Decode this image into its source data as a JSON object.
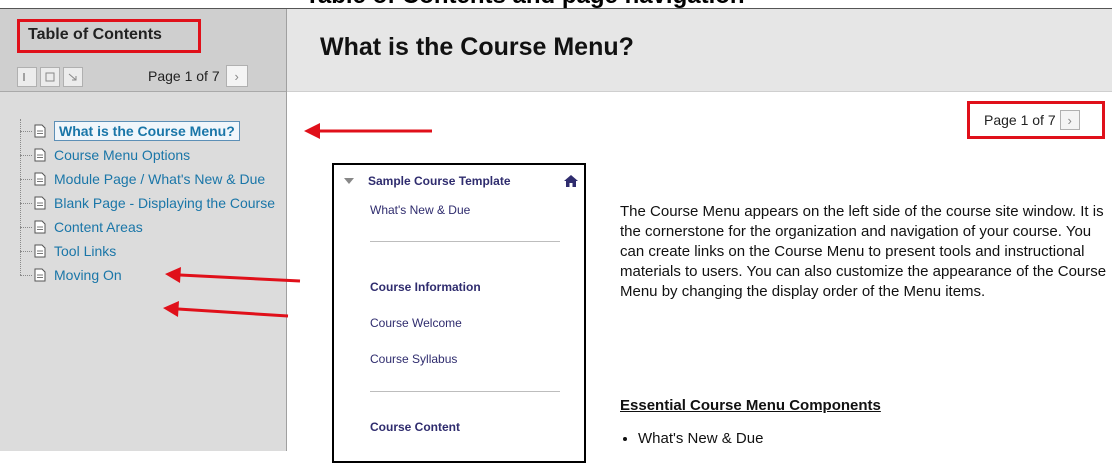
{
  "caption": {
    "text": "Table of Contents and page navigation"
  },
  "toc": {
    "title": "Table of Contents",
    "pager": {
      "label": "Page 1 of 7",
      "next_icon": "chevron-right-icon"
    },
    "controls": [
      "collapse-icon",
      "window-icon",
      "expand-icon"
    ],
    "items": [
      {
        "label": "What is the Course Menu?",
        "active": true
      },
      {
        "label": "Course Menu Options"
      },
      {
        "label": "Module Page / What's New & Due"
      },
      {
        "label": "Blank Page - Displaying the Course"
      },
      {
        "label": "Content Areas"
      },
      {
        "label": "Tool Links"
      },
      {
        "label": "Moving On"
      }
    ]
  },
  "main": {
    "title": "What is the Course Menu?",
    "pager": {
      "label": "Page 1 of 7"
    },
    "course_menu": {
      "title": "Sample Course Template",
      "rows": [
        "What's New & Due",
        "Course Information",
        "Course Welcome",
        "Course Syllabus",
        "Course Content"
      ]
    },
    "intro": "The Course Menu appears on the left side of the course site window. It is the cornerstone for the organization and navigation of your course. You can create links on the Course Menu to present tools and instructional materials to users. You can also customize the appearance of the Course Menu by changing the display order of the Menu items.",
    "section_title": "Essential Course Menu Components",
    "bullets": [
      "What's New & Due"
    ]
  },
  "colors": {
    "annotation_red": "#e0101a",
    "link_blue": "#1a76a8",
    "menu_navy": "#2f2c6e"
  }
}
